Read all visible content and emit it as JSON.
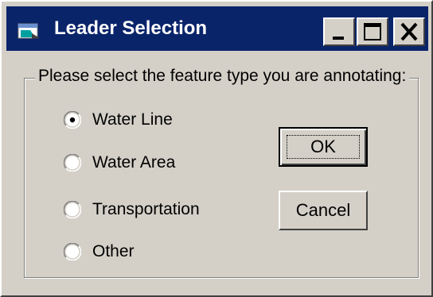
{
  "window": {
    "title": "Leader Selection",
    "titlebar_color": "#0a246a",
    "controls": {
      "minimize": "minimize-icon",
      "maximize": "maximize-icon",
      "close": "close-icon"
    }
  },
  "group": {
    "label": "Please select the feature type you are annotating:"
  },
  "options": [
    {
      "label": "Water Line",
      "selected": true
    },
    {
      "label": "Water Area",
      "selected": false
    },
    {
      "label": "Transportation",
      "selected": false
    },
    {
      "label": "Other",
      "selected": false
    }
  ],
  "buttons": {
    "ok_label": "OK",
    "cancel_label": "Cancel"
  }
}
